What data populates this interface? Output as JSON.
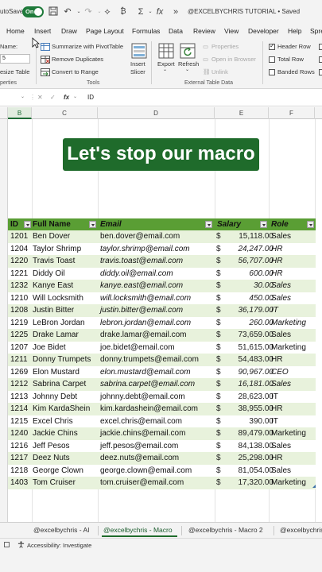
{
  "titlebar": {
    "autosave_label": "utoSave",
    "toggle_text": "On",
    "doc_title": "@EXCELBYCHRIS TUTORIAL • Saved"
  },
  "tabs": [
    "Home",
    "Insert",
    "Draw",
    "Page Layout",
    "Formulas",
    "Data",
    "Review",
    "View",
    "Developer",
    "Help",
    "Spre"
  ],
  "ribbon": {
    "name_label": "Name:",
    "name_value": "5",
    "resize_table": "esize Table",
    "properties_group": "perties",
    "summarize": "Summarize with PivotTable",
    "remove_duplicates": "Remove Duplicates",
    "convert_to_range": "Convert to Range",
    "tools_group": "Tools",
    "insert_slicer": [
      "Insert",
      "Slicer"
    ],
    "export": "Export",
    "refresh": "Refresh",
    "properties": "Properties",
    "open_in_browser": "Open in Browser",
    "unlink": "Unlink",
    "external_group": "External Table Data",
    "header_row": "Header Row",
    "total_row": "Total Row",
    "banded_rows": "Banded Rows",
    "header_row_checked": true,
    "total_row_checked": false,
    "banded_rows_checked": false
  },
  "formula_bar": {
    "fx": "fx",
    "content": "ID"
  },
  "columns": [
    "B",
    "C",
    "D",
    "E",
    "F"
  ],
  "banner": "Let's stop our macro",
  "table": {
    "headers": [
      "ID",
      "Full Name",
      "Email",
      "Salary",
      "Role"
    ],
    "rows": [
      {
        "id": "1201",
        "name": "Ben Dover",
        "email": "ben.dover@email.com",
        "cur": "$",
        "salary": "15,118.00",
        "role": "Sales",
        "italic": false
      },
      {
        "id": "1204",
        "name": "Taylor Shrimp",
        "email": "taylor.shrimp@email.com",
        "cur": "$",
        "salary": "24,247.00",
        "role": "HR",
        "italic": true
      },
      {
        "id": "1220",
        "name": "Travis Toast",
        "email": "travis.toast@email.com",
        "cur": "$",
        "salary": "56,707.00",
        "role": "HR",
        "italic": true
      },
      {
        "id": "1221",
        "name": "Diddy Oil",
        "email": "diddy.oil@email.com",
        "cur": "$",
        "salary": "600.00",
        "role": "HR",
        "italic": true
      },
      {
        "id": "1232",
        "name": "Kanye East",
        "email": "kanye.east@email.com",
        "cur": "$",
        "salary": "30.00",
        "role": "Sales",
        "italic": true
      },
      {
        "id": "1210",
        "name": "Will Locksmith",
        "email": "will.locksmith@email.com",
        "cur": "$",
        "salary": "450.00",
        "role": "Sales",
        "italic": true
      },
      {
        "id": "1208",
        "name": "Justin Bitter",
        "email": "justin.bitter@email.com",
        "cur": "$",
        "salary": "36,179.00",
        "role": "IT",
        "italic": true
      },
      {
        "id": "1219",
        "name": "LeBron Jordan",
        "email": "lebron.jordan@email.com",
        "cur": "$",
        "salary": "260.00",
        "role": "Marketing",
        "italic": true
      },
      {
        "id": "1225",
        "name": "Drake Lamar",
        "email": "drake.lamar@email.com",
        "cur": "$",
        "salary": "73,659.00",
        "role": "Sales",
        "italic": false
      },
      {
        "id": "1207",
        "name": "Joe Bidet",
        "email": "joe.bidet@email.com",
        "cur": "$",
        "salary": "51,615.00",
        "role": "Marketing",
        "italic": false
      },
      {
        "id": "1211",
        "name": "Donny Trumpets",
        "email": "donny.trumpets@email.com",
        "cur": "$",
        "salary": "54,483.00",
        "role": "HR",
        "italic": false
      },
      {
        "id": "1269",
        "name": "Elon Mustard",
        "email": "elon.mustard@email.com",
        "cur": "$",
        "salary": "90,967.00",
        "role": "CEO",
        "italic": true
      },
      {
        "id": "1212",
        "name": "Sabrina Carpet",
        "email": "sabrina.carpet@email.com",
        "cur": "$",
        "salary": "16,181.00",
        "role": "Sales",
        "italic": true
      },
      {
        "id": "1213",
        "name": "Johnny Debt",
        "email": "johnny.debt@email.com",
        "cur": "$",
        "salary": "28,623.00",
        "role": "IT",
        "italic": false
      },
      {
        "id": "1214",
        "name": "Kim KardaShein",
        "email": "kim.kardashein@email.com",
        "cur": "$",
        "salary": "38,955.00",
        "role": "HR",
        "italic": false
      },
      {
        "id": "1215",
        "name": "Excel Chris",
        "email": "excel.chris@email.com",
        "cur": "$",
        "salary": "390.00",
        "role": "IT",
        "italic": false
      },
      {
        "id": "1240",
        "name": "Jackie Chins",
        "email": "jackie.chins@email.com",
        "cur": "$",
        "salary": "89,479.00",
        "role": "Marketing",
        "italic": false
      },
      {
        "id": "1216",
        "name": "Jeff Pesos",
        "email": "jeff.pesos@email.com",
        "cur": "$",
        "salary": "84,138.00",
        "role": "Sales",
        "italic": false
      },
      {
        "id": "1217",
        "name": "Deez Nuts",
        "email": "deez.nuts@email.com",
        "cur": "$",
        "salary": "25,298.00",
        "role": "HR",
        "italic": false
      },
      {
        "id": "1218",
        "name": "George Clown",
        "email": "george.clown@email.com",
        "cur": "$",
        "salary": "81,054.00",
        "role": "Sales",
        "italic": false
      },
      {
        "id": "1403",
        "name": "Tom Cruiser",
        "email": "tom.cruiser@email.com",
        "cur": "$",
        "salary": "17,320.00",
        "role": "Marketing",
        "italic": false
      }
    ]
  },
  "sheet_tabs": [
    "@excelbychris - AI",
    "@excelbychris - Macro",
    "@excelbychris - Macro 2",
    "@excelbychris"
  ],
  "active_sheet_index": 1,
  "status": {
    "accessibility": "Accessibility: Investigate"
  },
  "colors": {
    "accent_green": "#1f6b2b",
    "table_header": "#5a9e34",
    "band": "#e8f2dc"
  }
}
